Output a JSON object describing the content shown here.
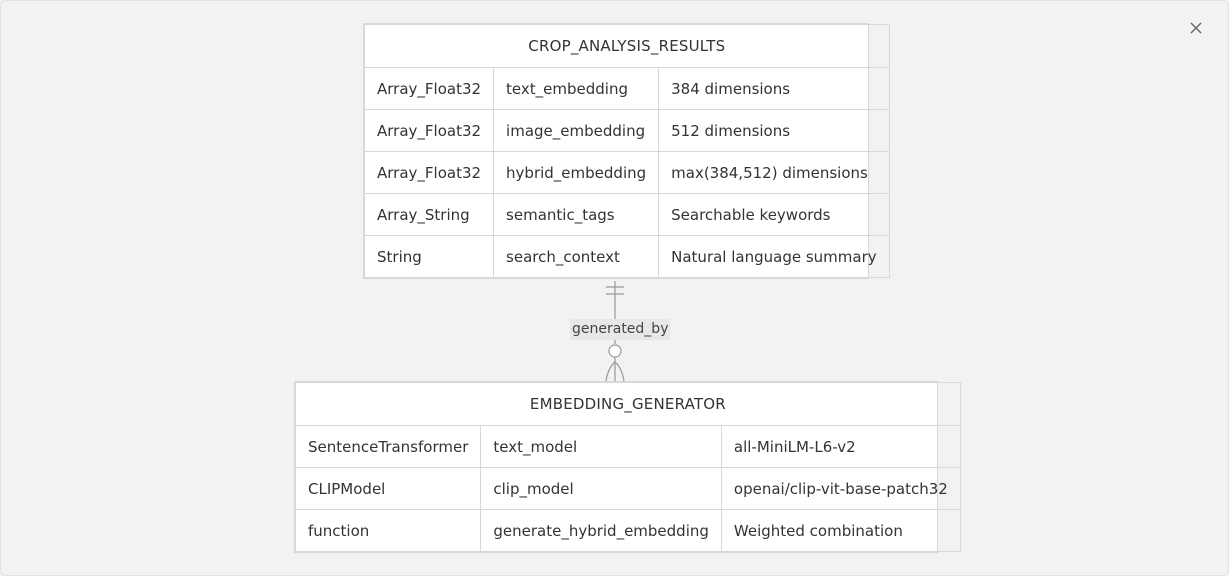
{
  "entities": [
    {
      "name": "CROP_ANALYSIS_RESULTS",
      "rows": [
        [
          "Array_Float32",
          "text_embedding",
          "384 dimensions"
        ],
        [
          "Array_Float32",
          "image_embedding",
          "512 dimensions"
        ],
        [
          "Array_Float32",
          "hybrid_embedding",
          "max(384,512) dimensions"
        ],
        [
          "Array_String",
          "semantic_tags",
          "Searchable keywords"
        ],
        [
          "String",
          "search_context",
          "Natural language summary"
        ]
      ]
    },
    {
      "name": "EMBEDDING_GENERATOR",
      "rows": [
        [
          "SentenceTransformer",
          "text_model",
          "all-MiniLM-L6-v2"
        ],
        [
          "CLIPModel",
          "clip_model",
          "openai/clip-vit-base-patch32"
        ],
        [
          "function",
          "generate_hybrid_embedding",
          "Weighted combination"
        ]
      ]
    }
  ],
  "relationship": {
    "label": "generated_by",
    "from_cardinality": "exactly-one",
    "to_cardinality": "zero-or-many"
  },
  "icons": {
    "close": "close-icon"
  },
  "colors": {
    "background": "#f3f2f1",
    "line": "#999999",
    "border": "#d8d8d8"
  }
}
